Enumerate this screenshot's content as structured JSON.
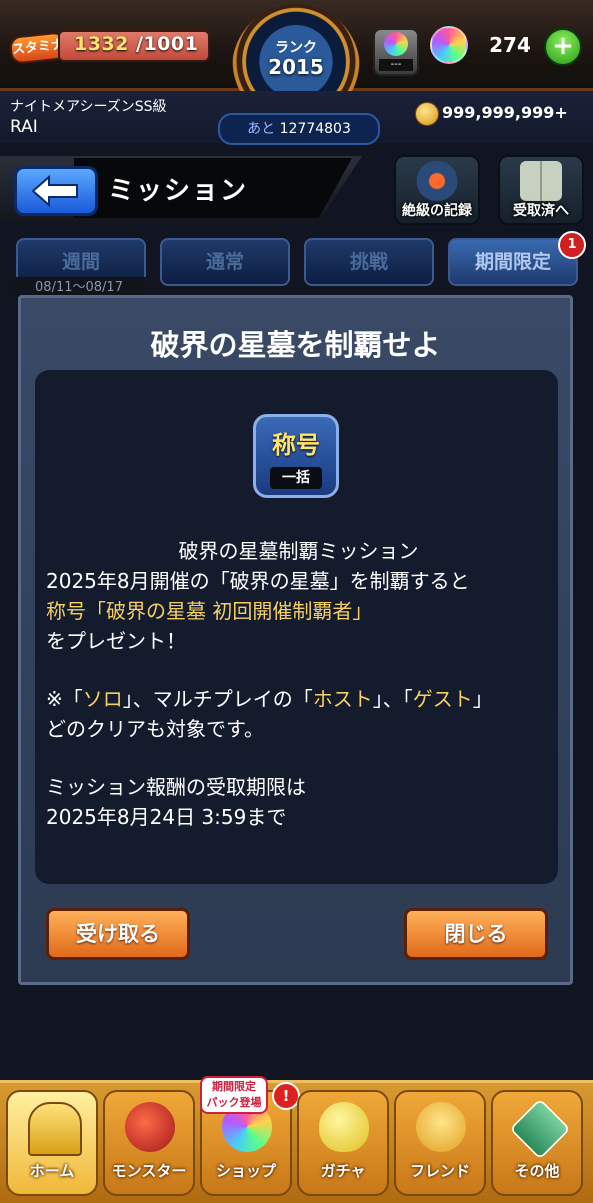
{
  "status": {
    "stamina_label": "スタミナ",
    "stamina_current": "1332",
    "stamina_max": "/1001",
    "rank_label": "ランク",
    "rank_value": "2015",
    "orb_device_value": "---",
    "orb_count": "274",
    "plus_label": "+",
    "season": "ナイトメアシーズンSS級",
    "player_name": "RAI",
    "next_rank_prefix": "あと",
    "next_rank_value": "12774803",
    "coins": "999,999,999+"
  },
  "header": {
    "title": "ミッション",
    "record_button": "絶級の記録",
    "received_button": "受取済へ"
  },
  "tabs": [
    {
      "label": "週間"
    },
    {
      "label": "通常"
    },
    {
      "label": "挑戦"
    },
    {
      "label": "期間限定",
      "badge": "1"
    }
  ],
  "period": "08/11〜08/17",
  "dialog": {
    "title": "破界の星墓を制覇せよ",
    "badge_top": "称号",
    "badge_bottom": "一括",
    "line1": "破界の星墓制覇ミッション",
    "line2": "2025年8月開催の「破界の星墓」を制覇すると",
    "line3": "称号「破界の星墓 初回開催制覇者」",
    "line4": "をプレゼント！",
    "line5_a": "※「",
    "line5_b": "ソロ",
    "line5_c": "」、マルチプレイの「",
    "line5_d": "ホスト",
    "line5_e": "」、「",
    "line5_f": "ゲスト",
    "line5_g": "」",
    "line6": "どのクリアも対象です。",
    "line7": "ミッション報酬の受取期限は",
    "line8": "2025年8月24日 3:59まで",
    "receive_button": "受け取る",
    "close_button": "閉じる"
  },
  "bottom_nav": {
    "home": "ホーム",
    "monster": "モンスター",
    "shop": "ショップ",
    "shop_badge_line1": "期間限定",
    "shop_badge_line2": "パック登場",
    "shop_alert": "!",
    "gacha": "ガチャ",
    "friend": "フレンド",
    "other": "その他"
  },
  "colors": {
    "accent_yellow": "#f5d060",
    "button_orange": "#e06a1a",
    "tab_blue": "#1e3a6a"
  }
}
